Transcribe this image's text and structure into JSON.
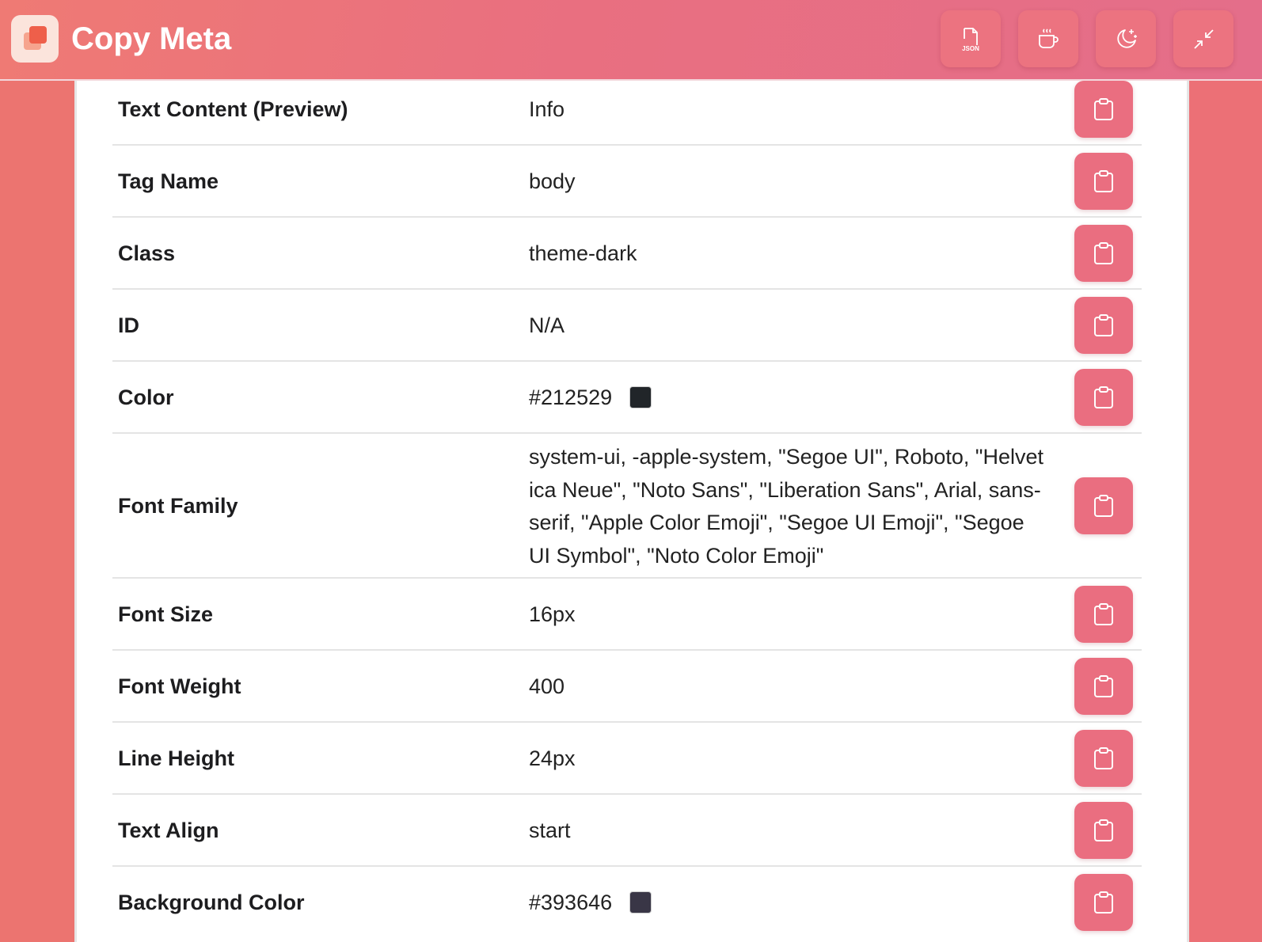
{
  "header": {
    "title": "Copy Meta",
    "json_label": "JSON",
    "icons": [
      "json-file-icon",
      "coffee-cup-icon",
      "moon-stars-icon",
      "minimize-arrows-icon"
    ]
  },
  "colors": {
    "accent": "#ea6e80",
    "background": "#ec7470"
  },
  "rows": [
    {
      "label": "Text Content (Preview)",
      "value": "Info"
    },
    {
      "label": "Tag Name",
      "value": "body"
    },
    {
      "label": "Class",
      "value": "theme-dark"
    },
    {
      "label": "ID",
      "value": "N/A"
    },
    {
      "label": "Color",
      "value": "#212529",
      "swatch": "#212529"
    },
    {
      "label": "Font Family",
      "value": "system-ui, -apple-system, \"Segoe UI\", Roboto, \"Helvetica Neue\", \"Noto Sans\", \"Liberation Sans\", Arial, sans-serif, \"Apple Color Emoji\", \"Segoe UI Emoji\", \"Segoe UI Symbol\", \"Noto Color Emoji\""
    },
    {
      "label": "Font Size",
      "value": "16px"
    },
    {
      "label": "Font Weight",
      "value": "400"
    },
    {
      "label": "Line Height",
      "value": "24px"
    },
    {
      "label": "Text Align",
      "value": "start"
    },
    {
      "label": "Background Color",
      "value": "#393646",
      "swatch": "#393646"
    }
  ]
}
